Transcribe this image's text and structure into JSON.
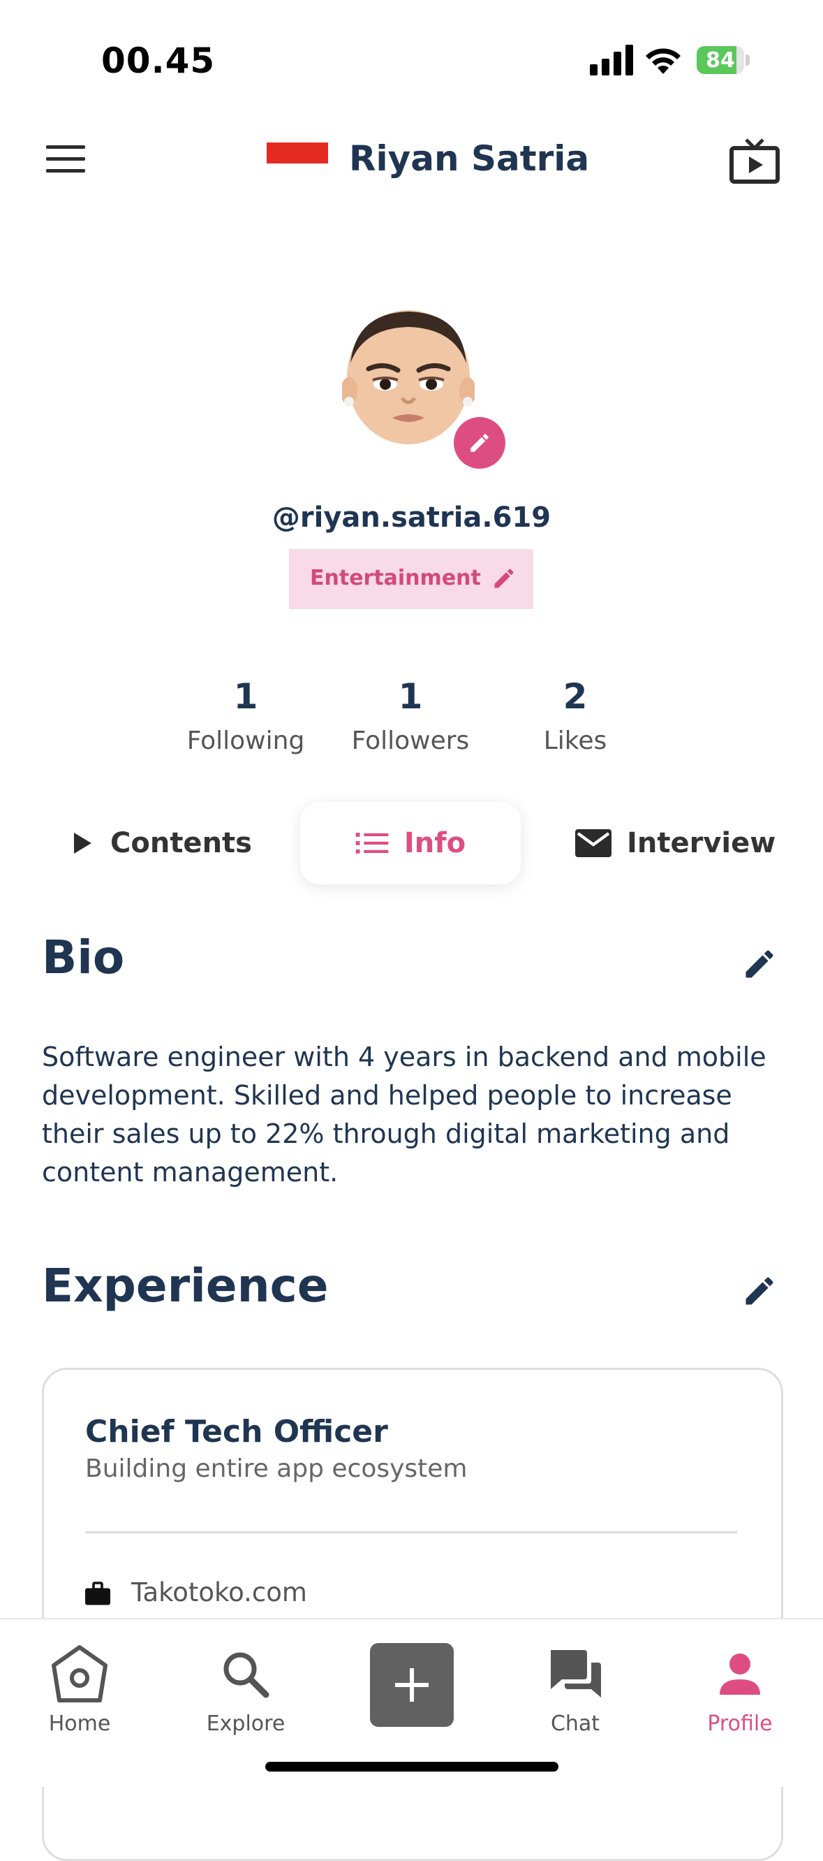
{
  "status_bar": {
    "time": "00.45",
    "battery": "84",
    "battery_level": 0.84,
    "icons": [
      "cellular-signal-icon",
      "wifi-icon",
      "battery-charging-icon"
    ]
  },
  "header": {
    "title": "Riyan Satria",
    "left_icon": "hamburger-menu-icon",
    "right_icon": "tv-play-icon",
    "flag": "indonesia-flag"
  },
  "profile": {
    "handle": "@riyan.satria.619",
    "category": "Entertainment",
    "avatar": "memoji-avatar"
  },
  "stats": [
    {
      "value": "1",
      "label": "Following"
    },
    {
      "value": "1",
      "label": "Followers"
    },
    {
      "value": "2",
      "label": "Likes"
    }
  ],
  "tabs": [
    {
      "label": "Contents",
      "icon": "play-icon"
    },
    {
      "label": "Info",
      "icon": "list-icon",
      "active": true
    },
    {
      "label": "Interview",
      "icon": "mail-icon"
    }
  ],
  "bio": {
    "title": "Bio",
    "text": "Software engineer with 4 years in backend and mobile development. Skilled and helped people to increase their sales up to 22% through digital marketing and content management."
  },
  "experience": {
    "title": "Experience",
    "items": [
      {
        "role": "Chief Tech Officer",
        "description": "Building entire app ecosystem",
        "company": "Takotoko.com"
      }
    ]
  },
  "bottom_nav": [
    {
      "label": "Home",
      "icon": "home-icon"
    },
    {
      "label": "Explore",
      "icon": "search-icon"
    },
    {
      "label": "",
      "icon": "plus-icon"
    },
    {
      "label": "Chat",
      "icon": "chat-icon"
    },
    {
      "label": "Profile",
      "icon": "person-icon",
      "active": true
    }
  ],
  "colors": {
    "accent": "#de4d81",
    "primary_text": "#1f3552",
    "category_bg": "#f8dbe7",
    "flag_red": "#e32b21",
    "battery_green": "#5ac85a"
  }
}
